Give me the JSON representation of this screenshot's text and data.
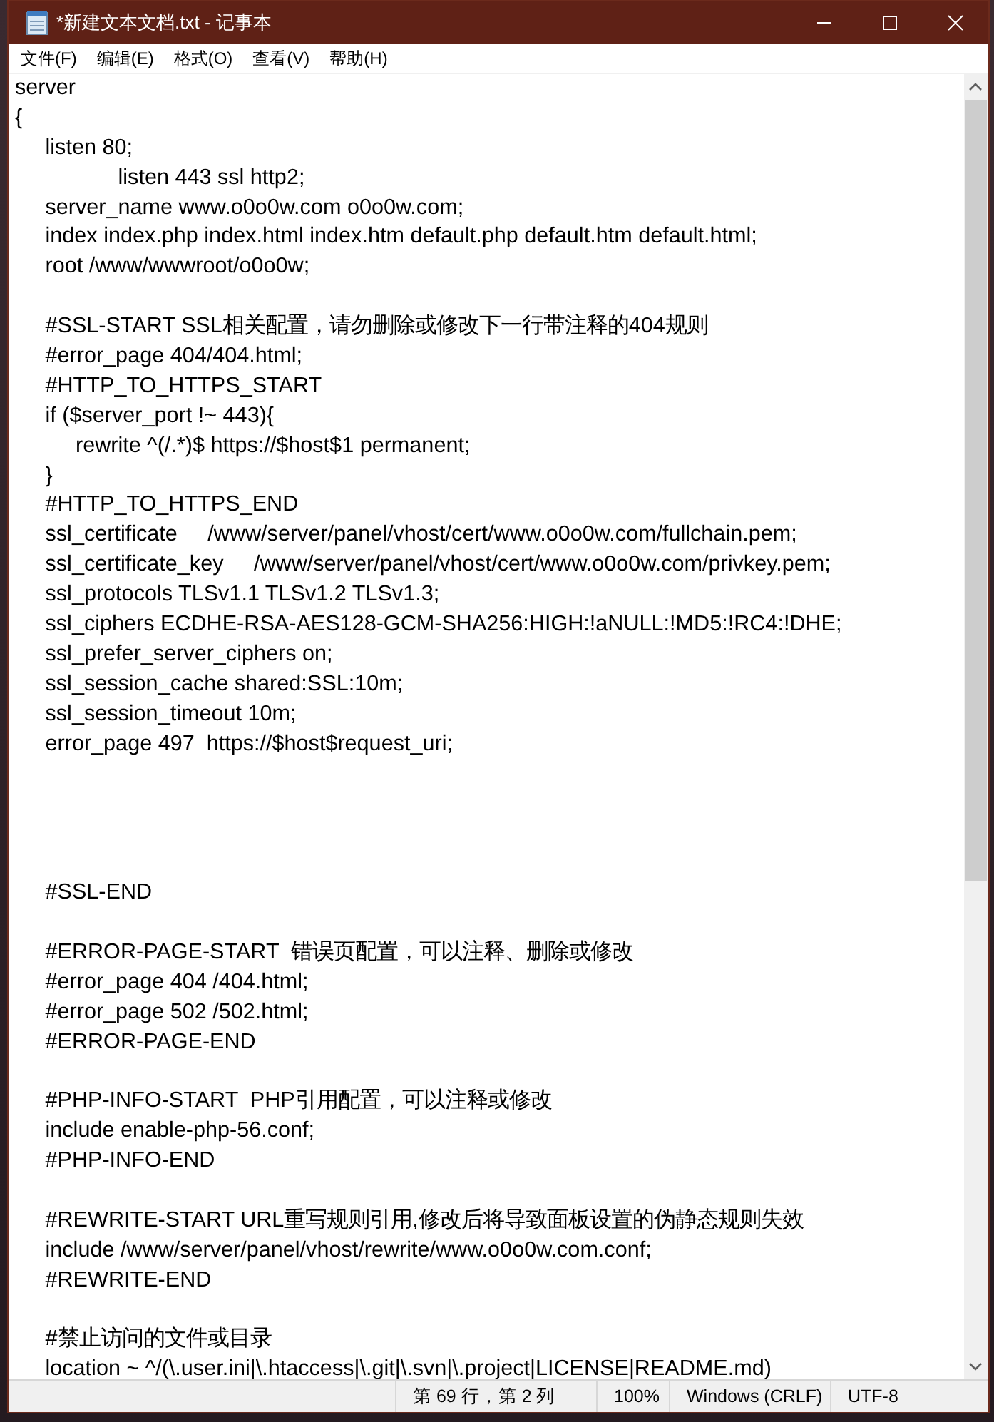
{
  "window": {
    "title": "*新建文本文档.txt - 记事本"
  },
  "menu": [
    {
      "label": "文件(F)"
    },
    {
      "label": "编辑(E)"
    },
    {
      "label": "格式(O)"
    },
    {
      "label": "查看(V)"
    },
    {
      "label": "帮助(H)"
    }
  ],
  "lines": [
    {
      "kind": "code",
      "text": "server"
    },
    {
      "kind": "code",
      "text": "{"
    },
    {
      "kind": "code",
      "text": "     listen 80;"
    },
    {
      "kind": "code",
      "text": "                 listen 443 ssl http2;"
    },
    {
      "kind": "code",
      "text": "     server_name www.o0o0w.com o0o0w.com;"
    },
    {
      "kind": "code",
      "text": "     index index.php index.html index.htm default.php default.htm default.html;"
    },
    {
      "kind": "code",
      "text": "     root /www/wwwroot/o0o0w;"
    },
    {
      "kind": "blank"
    },
    {
      "kind": "code",
      "text": "     #SSL-START SSL相关配置，请勿删除或修改下一行带注释的404规则"
    },
    {
      "kind": "code",
      "text": "     #error_page 404/404.html;"
    },
    {
      "kind": "code",
      "text": "     #HTTP_TO_HTTPS_START"
    },
    {
      "kind": "code",
      "text": "     if ($server_port !~ 443){"
    },
    {
      "kind": "code",
      "text": "          rewrite ^(/.*)$ https://$host$1 permanent;"
    },
    {
      "kind": "code",
      "text": "     }"
    },
    {
      "kind": "code",
      "text": "     #HTTP_TO_HTTPS_END"
    },
    {
      "kind": "code",
      "text": "     ssl_certificate     /www/server/panel/vhost/cert/www.o0o0w.com/fullchain.pem;"
    },
    {
      "kind": "code",
      "text": "     ssl_certificate_key     /www/server/panel/vhost/cert/www.o0o0w.com/privkey.pem;"
    },
    {
      "kind": "code",
      "text": "     ssl_protocols TLSv1.1 TLSv1.2 TLSv1.3;"
    },
    {
      "kind": "code",
      "text": "     ssl_ciphers ECDHE-RSA-AES128-GCM-SHA256:HIGH:!aNULL:!MD5:!RC4:!DHE;"
    },
    {
      "kind": "code",
      "text": "     ssl_prefer_server_ciphers on;"
    },
    {
      "kind": "code",
      "text": "     ssl_session_cache shared:SSL:10m;"
    },
    {
      "kind": "code",
      "text": "     ssl_session_timeout 10m;"
    },
    {
      "kind": "code",
      "text": "     error_page 497  https://$host$request_uri;"
    },
    {
      "kind": "blank"
    },
    {
      "kind": "blank"
    },
    {
      "kind": "blank"
    },
    {
      "kind": "blank"
    },
    {
      "kind": "code",
      "text": "     #SSL-END"
    },
    {
      "kind": "blank"
    },
    {
      "kind": "code",
      "text": "     #ERROR-PAGE-START  错误页配置，可以注释、删除或修改"
    },
    {
      "kind": "code",
      "text": "     #error_page 404 /404.html;"
    },
    {
      "kind": "code",
      "text": "     #error_page 502 /502.html;"
    },
    {
      "kind": "code",
      "text": "     #ERROR-PAGE-END"
    },
    {
      "kind": "blank"
    },
    {
      "kind": "code",
      "text": "     #PHP-INFO-START  PHP引用配置，可以注释或修改"
    },
    {
      "kind": "code",
      "text": "     include enable-php-56.conf;"
    },
    {
      "kind": "code",
      "text": "     #PHP-INFO-END"
    },
    {
      "kind": "blank"
    },
    {
      "kind": "code",
      "text": "     #REWRITE-START URL重写规则引用,修改后将导致面板设置的伪静态规则失效"
    },
    {
      "kind": "code",
      "text": "     include /www/server/panel/vhost/rewrite/www.o0o0w.com.conf;"
    },
    {
      "kind": "code",
      "text": "     #REWRITE-END"
    },
    {
      "kind": "blank"
    },
    {
      "kind": "code",
      "text": "     #禁止访问的文件或目录"
    },
    {
      "kind": "code",
      "text": "     location ~ ^/(\\.user.ini|\\.htaccess|\\.git|\\.svn|\\.project|LICENSE|README.md)"
    }
  ],
  "status_bar": {
    "position": "第 69 行，第 2 列",
    "zoom": "100%",
    "line_ending": "Windows (CRLF)",
    "encoding": "UTF-8"
  }
}
